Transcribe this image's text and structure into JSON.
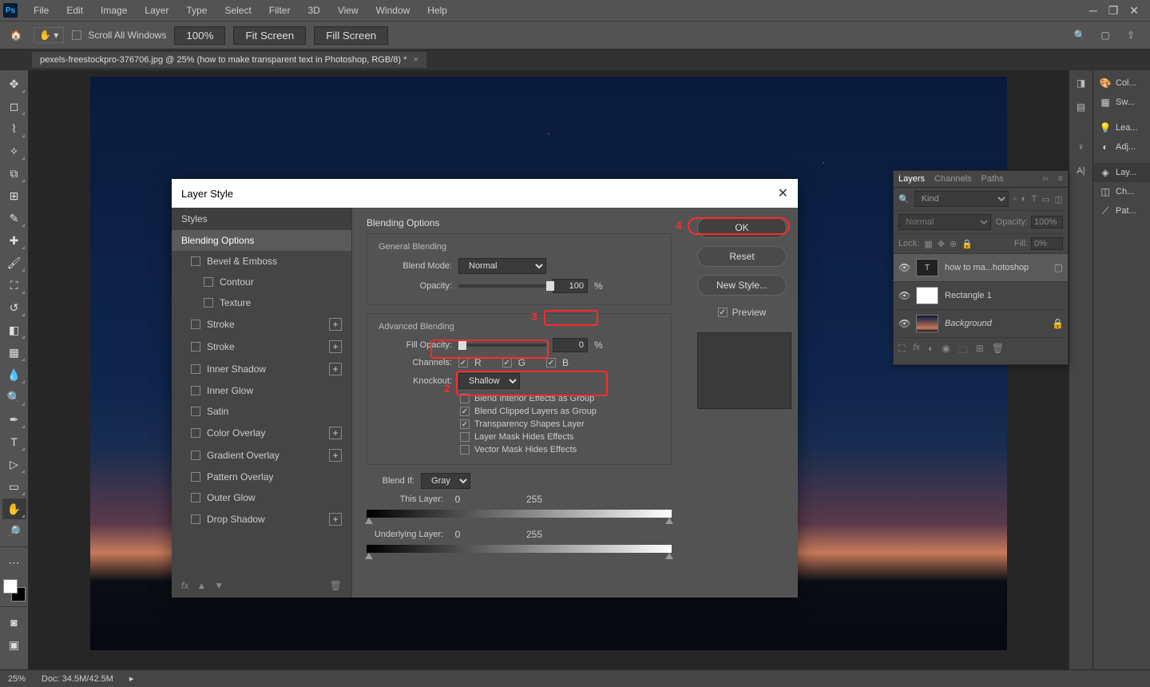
{
  "menubar": {
    "items": [
      "File",
      "Edit",
      "Image",
      "Layer",
      "Type",
      "Select",
      "Filter",
      "3D",
      "View",
      "Window",
      "Help"
    ]
  },
  "optbar": {
    "scroll_all": "Scroll All Windows",
    "zoom": "100%",
    "fit": "Fit Screen",
    "fill": "Fill Screen"
  },
  "doc_tab": {
    "title": "pexels-freestockpro-376706.jpg @ 25% (how to make transparent text in Photoshop, RGB/8) *"
  },
  "dialog": {
    "title": "Layer Style",
    "sidebar": {
      "head": "Styles",
      "active": "Blending Options",
      "items": [
        {
          "label": "Bevel & Emboss",
          "cb": true,
          "plus": false,
          "indent": 0
        },
        {
          "label": "Contour",
          "cb": true,
          "plus": false,
          "indent": 1
        },
        {
          "label": "Texture",
          "cb": true,
          "plus": false,
          "indent": 1
        },
        {
          "label": "Stroke",
          "cb": true,
          "plus": true,
          "indent": 0
        },
        {
          "label": "Stroke",
          "cb": true,
          "plus": true,
          "indent": 0
        },
        {
          "label": "Inner Shadow",
          "cb": true,
          "plus": true,
          "indent": 0
        },
        {
          "label": "Inner Glow",
          "cb": true,
          "plus": false,
          "indent": 0
        },
        {
          "label": "Satin",
          "cb": true,
          "plus": false,
          "indent": 0
        },
        {
          "label": "Color Overlay",
          "cb": true,
          "plus": true,
          "indent": 0
        },
        {
          "label": "Gradient Overlay",
          "cb": true,
          "plus": true,
          "indent": 0
        },
        {
          "label": "Pattern Overlay",
          "cb": true,
          "plus": false,
          "indent": 0
        },
        {
          "label": "Outer Glow",
          "cb": true,
          "plus": false,
          "indent": 0
        },
        {
          "label": "Drop Shadow",
          "cb": true,
          "plus": true,
          "indent": 0
        }
      ]
    },
    "main": {
      "title": "Blending Options",
      "general": {
        "title": "General Blending",
        "blend_mode_label": "Blend Mode:",
        "blend_mode": "Normal",
        "opacity_label": "Opacity:",
        "opacity": "100",
        "pct": "%"
      },
      "advanced": {
        "title": "Advanced Blending",
        "fill_label": "Fill Opacity:",
        "fill": "0",
        "pct": "%",
        "channels_label": "Channels:",
        "r": "R",
        "g": "G",
        "b": "B",
        "knockout_label": "Knockout:",
        "knockout": "Shallow",
        "checks": [
          {
            "label": "Blend Interior Effects as Group",
            "checked": false
          },
          {
            "label": "Blend Clipped Layers as Group",
            "checked": true
          },
          {
            "label": "Transparency Shapes Layer",
            "checked": true
          },
          {
            "label": "Layer Mask Hides Effects",
            "checked": false
          },
          {
            "label": "Vector Mask Hides Effects",
            "checked": false
          }
        ]
      },
      "blendif": {
        "label": "Blend If:",
        "value": "Gray",
        "this_layer": "This Layer:",
        "this_lo": "0",
        "this_hi": "255",
        "under_layer": "Underlying Layer:",
        "under_lo": "0",
        "under_hi": "255"
      }
    },
    "buttons": {
      "ok": "OK",
      "reset": "Reset",
      "new_style": "New Style...",
      "preview": "Preview"
    }
  },
  "layers_panel": {
    "tabs": [
      "Layers",
      "Channels",
      "Paths"
    ],
    "kind": "Kind",
    "mode": "Normal",
    "opacity_label": "Opacity:",
    "opacity": "100%",
    "lock_label": "Lock:",
    "fill_label": "Fill:",
    "fill": "0%",
    "layers": [
      {
        "name": "how to ma...hotoshop",
        "type": "T",
        "sel": true
      },
      {
        "name": "Rectangle 1",
        "type": "rect",
        "sel": false
      },
      {
        "name": "Background",
        "type": "bg",
        "locked": true,
        "sel": false,
        "italic": true
      }
    ]
  },
  "right_tabs": {
    "items": [
      "Col...",
      "Sw...",
      "Lea...",
      "Adj...",
      "Lay...",
      "Ch...",
      "Pat..."
    ],
    "selected": 4
  },
  "statusbar": {
    "zoom": "25%",
    "doc": "Doc: 34.5M/42.5M"
  },
  "annotations": {
    "n2": "2",
    "n3": "3",
    "n4": "4"
  }
}
